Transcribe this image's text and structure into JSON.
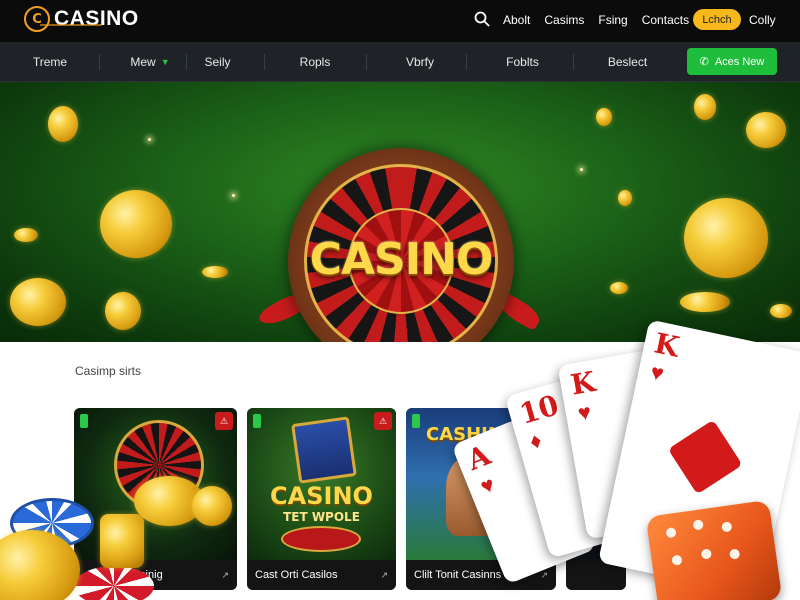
{
  "header": {
    "logo_text": "CASINO",
    "logo_mark": "C",
    "links": [
      "Abolt",
      "Casims",
      "Fsing",
      "Contacts"
    ],
    "launch_label": "Lchch",
    "lang_label": "Colly"
  },
  "nav": {
    "items": [
      "Treme",
      "Mew",
      "Seily",
      "Ropls",
      "Vbrfy",
      "Foblts",
      "Beslect"
    ],
    "cta_label": "Aces New",
    "cta_icon": "phone-icon"
  },
  "hero": {
    "title": "CASINO"
  },
  "content": {
    "section_label": "Casimp sirts",
    "cards": [
      {
        "name": "Casinig",
        "caption": "",
        "badge": "⚠"
      },
      {
        "name": "Cast Orti Casilos",
        "caption_line1": "CASINO",
        "caption_line2": "TET WPOLE",
        "badge": "⚠"
      },
      {
        "name": "Clilt Tonit Casinns",
        "caption_line1": "CASHINO",
        "caption_line2": "",
        "badge": ""
      }
    ],
    "card_arrow": "↗"
  },
  "overlay": {
    "playing_cards": [
      {
        "rank": "A",
        "suit": "♥"
      },
      {
        "rank": "10",
        "suit": "♦"
      },
      {
        "rank": "K",
        "suit": "♥"
      },
      {
        "rank": "K",
        "suit": "♥"
      }
    ]
  },
  "colors": {
    "accent_orange": "#f3a01e",
    "cta_green": "#1fbd3c",
    "launch_yellow": "#f7b81c",
    "hero_green": "#2f8a24"
  }
}
